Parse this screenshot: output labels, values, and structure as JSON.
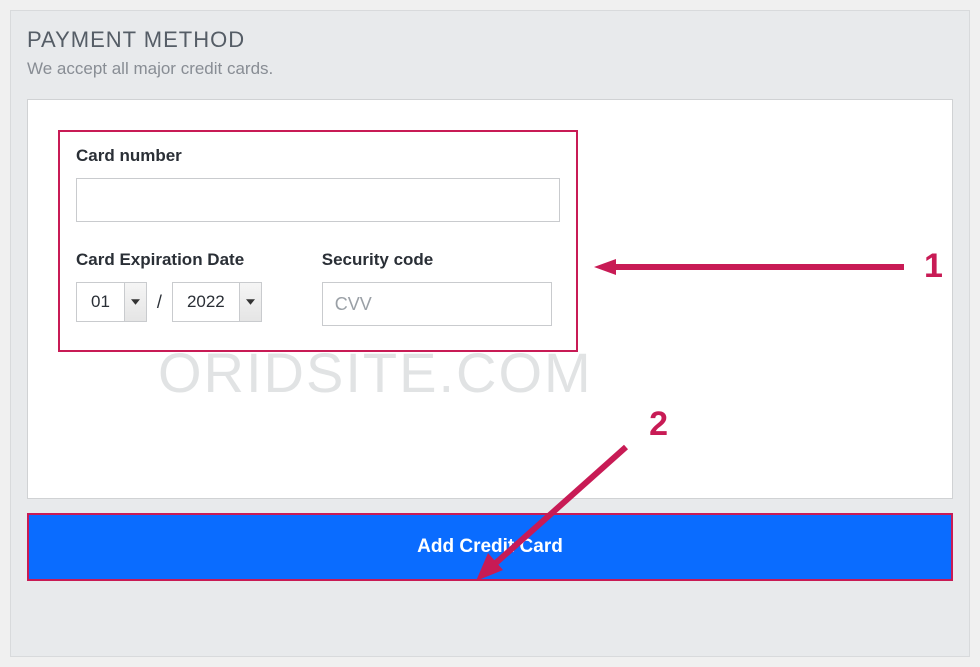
{
  "header": {
    "title": "PAYMENT METHOD",
    "subtitle": "We accept all major credit cards."
  },
  "form": {
    "card_number_label": "Card number",
    "card_number_value": "",
    "expiration_label": "Card Expiration Date",
    "expiration_month": "01",
    "expiration_year": "2022",
    "security_label": "Security code",
    "cvv_placeholder": "CVV",
    "cvv_value": ""
  },
  "button": {
    "add_card": "Add Credit Card"
  },
  "watermark": "ORIDSITE.COM",
  "annotations": {
    "one": "1",
    "two": "2"
  }
}
